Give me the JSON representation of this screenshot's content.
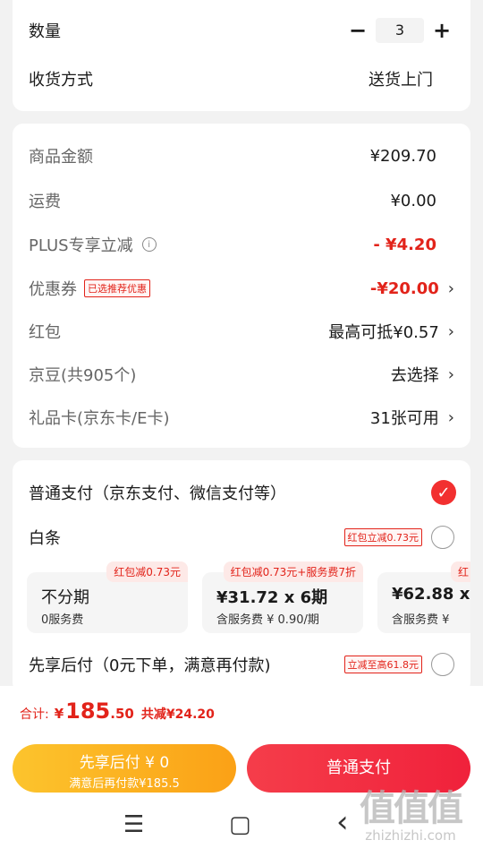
{
  "qty": {
    "label": "数量",
    "value": "3",
    "minus": "−",
    "plus": "+"
  },
  "delivery": {
    "label": "收货方式",
    "value": "送货上门"
  },
  "summary": {
    "goods": {
      "label": "商品金额",
      "value": "¥209.70"
    },
    "freight": {
      "label": "运费",
      "value": "¥0.00"
    },
    "plus": {
      "label": "PLUS专享立减",
      "value": "- ¥4.20",
      "info_icon": "i"
    },
    "coupon": {
      "label": "优惠券",
      "tag": "已选推荐优惠",
      "value": "-¥20.00"
    },
    "redpacket": {
      "label": "红包",
      "value": "最高可抵¥0.57"
    },
    "jingdou": {
      "label": "京豆(共905个)",
      "value": "去选择"
    },
    "giftcard": {
      "label": "礼品卡(京东卡/E卡)",
      "value": "31张可用"
    },
    "chevron": "›"
  },
  "payment": {
    "normal": {
      "label": "普通支付（京东支付、微信支付等）",
      "check": "✓"
    },
    "baitiao": {
      "label": "白条",
      "tag": "红包立减0.73元"
    },
    "installments": [
      {
        "badge": "红包减0.73元",
        "main": "不分期",
        "sub": "0服务费"
      },
      {
        "badge": "红包减0.73元+服务费7折",
        "main": "¥31.72 x 6期",
        "sub": "含服务费 ¥ 0.90/期"
      },
      {
        "badge": "红",
        "main": "¥62.88 x",
        "sub": "含服务费 ¥"
      }
    ],
    "later": {
      "label": "先享后付（0元下单，满意再付款)",
      "tag": "立减至高61.8元"
    }
  },
  "footer": {
    "total_label": "合计:",
    "currency": "¥",
    "total_int": "185",
    "total_dec": ".50",
    "saved": "共减¥24.20",
    "later_btn": {
      "title": "先享后付 ¥ 0",
      "sub": "满意后再付款¥185.5"
    },
    "pay_btn": "普通支付"
  },
  "colors": {
    "accent": "#f23030",
    "orange": "#fbb321"
  },
  "nav": {
    "menu": "☰",
    "home": "▢",
    "back": "‹"
  },
  "watermark": {
    "text": "值值值",
    "url": "zhizhizhi.com"
  }
}
